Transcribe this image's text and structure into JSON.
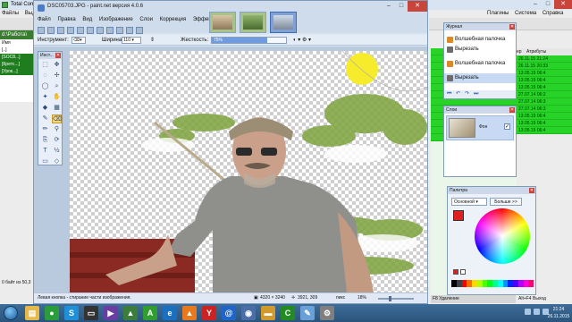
{
  "total_commander": {
    "title": "Total Comr",
    "menu_left": [
      "Файлы",
      "Выделе"
    ],
    "menu_right": [
      "Плагины",
      "Система",
      "Справка"
    ],
    "left_path": "d:\\Работа\\",
    "left_header": "Имя",
    "left_items": [
      "[..]",
      "[SOC8...]",
      "[Кретс...]",
      "[Урок...]"
    ],
    "left_status": "0 байт из 50,3",
    "right_columns": [
      "ер",
      "Атрибуты"
    ],
    "right_items": [
      "26.11.15 21:24",
      "26.11.15 20:33",
      "13.05.15 06:4",
      "13.05.15 06:4",
      "13.05.15 06:4",
      "27.07.14 06:2",
      "27.07.14 06:3",
      "27.07.14 06:3",
      "13.05.15 06:4",
      "13.05.15 06:4",
      "13.05.15 06:4"
    ],
    "right_fn": "F8 Удаление",
    "right_status": "Alt+F4 Выход"
  },
  "paint": {
    "title": "DSC05703.JPG - paint.net версия 4.0.6",
    "menu": [
      "Файл",
      "Правка",
      "Вид",
      "Изображение",
      "Слои",
      "Коррекция",
      "Эффекты"
    ],
    "toolbar": {
      "tool_label": "Инструмент:",
      "width_label": "Ширина:",
      "width_value": "110",
      "hardness_label": "Жесткость:",
      "hardness_value": "75%",
      "hardness_fraction": 0.75
    },
    "status": {
      "hint": "Левая кнопка - стирание части изображения.",
      "image_size": "4320 × 3240",
      "cursor_pos": "3921, 309",
      "unit": "пикс",
      "zoom": "18%"
    }
  },
  "tools_panel": {
    "title": "Инст..."
  },
  "history_panel": {
    "title": "Журнал",
    "items": [
      {
        "text": "Волшебная палочка",
        "selected": false
      },
      {
        "text": "Вырезать",
        "selected": false
      },
      {
        "text": "Волшебная палочка",
        "selected": false
      },
      {
        "text": "Вырезать",
        "selected": true
      }
    ]
  },
  "layers_panel": {
    "title": "Слои",
    "layer_name": "Фон"
  },
  "palette_panel": {
    "title": "Палитра",
    "mode": "Основной",
    "more_button": "Больше >>",
    "primary_color": "#e11f1f",
    "secondary_color": "#ffffff"
  },
  "taskbar": {
    "time": "21:24",
    "date": "26.11.2015",
    "apps": [
      {
        "icon": "explorer-icon",
        "color": "#e7b94a",
        "glyph": "▤"
      },
      {
        "icon": "chrome-icon",
        "color": "#2a9d3b",
        "glyph": "●"
      },
      {
        "icon": "skype-icon",
        "color": "#1d90d8",
        "glyph": "S"
      },
      {
        "icon": "terminal-icon",
        "color": "#333333",
        "glyph": "▭"
      },
      {
        "icon": "media-icon",
        "color": "#6a3da3",
        "glyph": "▶"
      },
      {
        "icon": "photo-icon",
        "color": "#3b7e3b",
        "glyph": "▲"
      },
      {
        "icon": "total-commander-icon",
        "color": "#2f9e2f",
        "glyph": "A"
      },
      {
        "icon": "ie-icon",
        "color": "#1b6fbf",
        "glyph": "e"
      },
      {
        "icon": "vlc-icon",
        "color": "#e8791d",
        "glyph": "▲"
      },
      {
        "icon": "yandex-icon",
        "color": "#cc2222",
        "glyph": "Y"
      },
      {
        "icon": "mail-icon",
        "color": "#2063c9",
        "glyph": "@"
      },
      {
        "icon": "camera-icon",
        "color": "#4a6fa8",
        "glyph": "◉"
      },
      {
        "icon": "folder-icon",
        "color": "#d19a2b",
        "glyph": "▬"
      },
      {
        "icon": "script-icon",
        "color": "#228b22",
        "glyph": "C"
      },
      {
        "icon": "paint-net-icon",
        "color": "#6aa0d8",
        "glyph": "✎"
      },
      {
        "icon": "settings-icon",
        "color": "#7f7f7f",
        "glyph": "⚙"
      }
    ]
  }
}
